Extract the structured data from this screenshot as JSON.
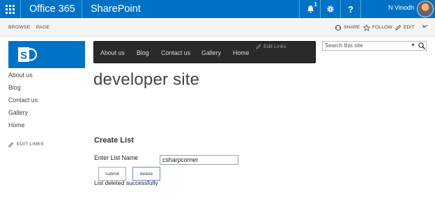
{
  "suite_bar": {
    "app_name": "Office 365",
    "product_name": "SharePoint",
    "notification_count": "1",
    "help_label": "?",
    "user_name": "N Vinodh",
    "colors": {
      "background": "#0072c6",
      "text": "#ffffff"
    }
  },
  "ribbon": {
    "tabs": [
      "BROWSE",
      "PAGE"
    ],
    "share_label": "SHARE",
    "follow_label": "FOLLOW",
    "edit_label": "EDIT"
  },
  "top_nav": {
    "items": [
      "About us",
      "Blog",
      "Contact us",
      "Gallery",
      "Home"
    ],
    "edit_links_label": "Edit Links"
  },
  "search": {
    "placeholder": "Search this site"
  },
  "left_nav": {
    "items": [
      "About us",
      "Blog",
      "Contact us",
      "Gallery",
      "Home"
    ],
    "edit_links_label": "EDIT LINKS"
  },
  "page": {
    "site_title": "developer site"
  },
  "form": {
    "title": "Create List",
    "list_name_label": "Enter List Name",
    "list_name_value": "csharpcorner",
    "submit_label": "submit",
    "delete_label": "delete",
    "status_message": "List deleted successfully"
  },
  "icons": {
    "app_launcher": "waffle-icon",
    "notifications": "bell-icon",
    "settings": "gear-icon",
    "share": "share-icon",
    "follow": "star-icon",
    "edit": "pencil-icon",
    "focus": "focus-content-icon",
    "search": "magnifier-icon"
  }
}
